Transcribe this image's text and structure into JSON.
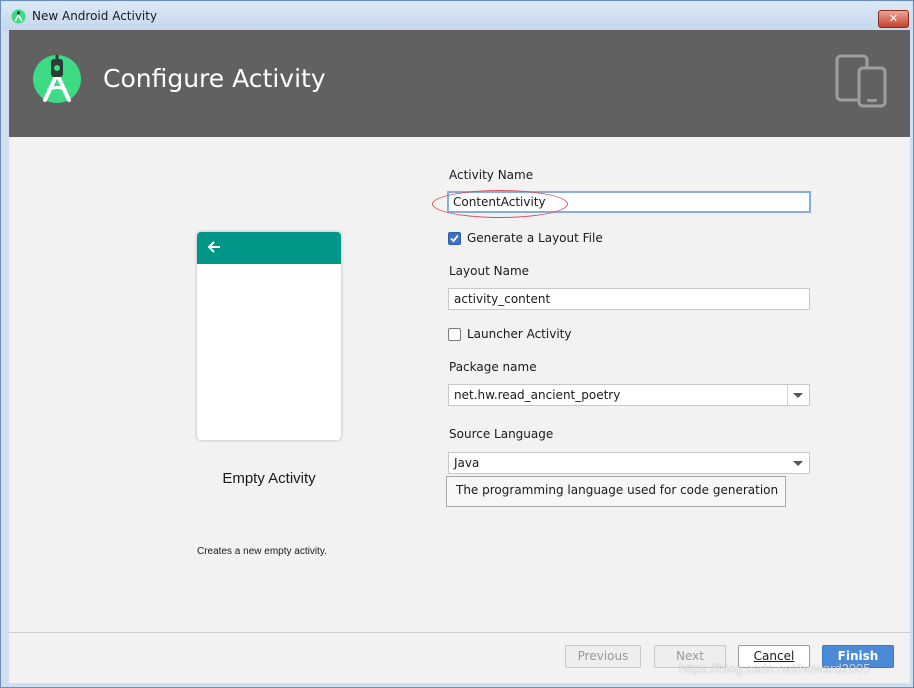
{
  "window": {
    "title": "New Android Activity",
    "close_glyph": "✕"
  },
  "header": {
    "title": "Configure Activity"
  },
  "template": {
    "name": "Empty Activity",
    "description": "Creates a new empty activity."
  },
  "form": {
    "activity_name": {
      "label": "Activity Name",
      "value": "ContentActivity"
    },
    "generate_layout": {
      "label": "Generate a Layout File",
      "checked": true
    },
    "layout_name": {
      "label": "Layout Name",
      "value": "activity_content"
    },
    "launcher_activity": {
      "label": "Launcher Activity",
      "checked": false
    },
    "package_name": {
      "label": "Package name",
      "value": "net.hw.read_ancient_poetry"
    },
    "source_language": {
      "label": "Source Language",
      "value": "Java",
      "tooltip": "The programming language used for code generation"
    }
  },
  "footer": {
    "previous": "Previous",
    "next": "Next",
    "cancel": "Cancel",
    "finish": "Finish"
  },
  "watermark": "https://blog.csdn.net/howard2005",
  "colors": {
    "header_bg": "#616161",
    "teal": "#009688",
    "android_green": "#3ddc84",
    "primary_button": "#4a8ad6",
    "annotation": "#e0505a"
  },
  "icons": {
    "app": "android-studio-icon",
    "devices": "phone-tablet-icon",
    "back": "arrow-left-icon"
  }
}
